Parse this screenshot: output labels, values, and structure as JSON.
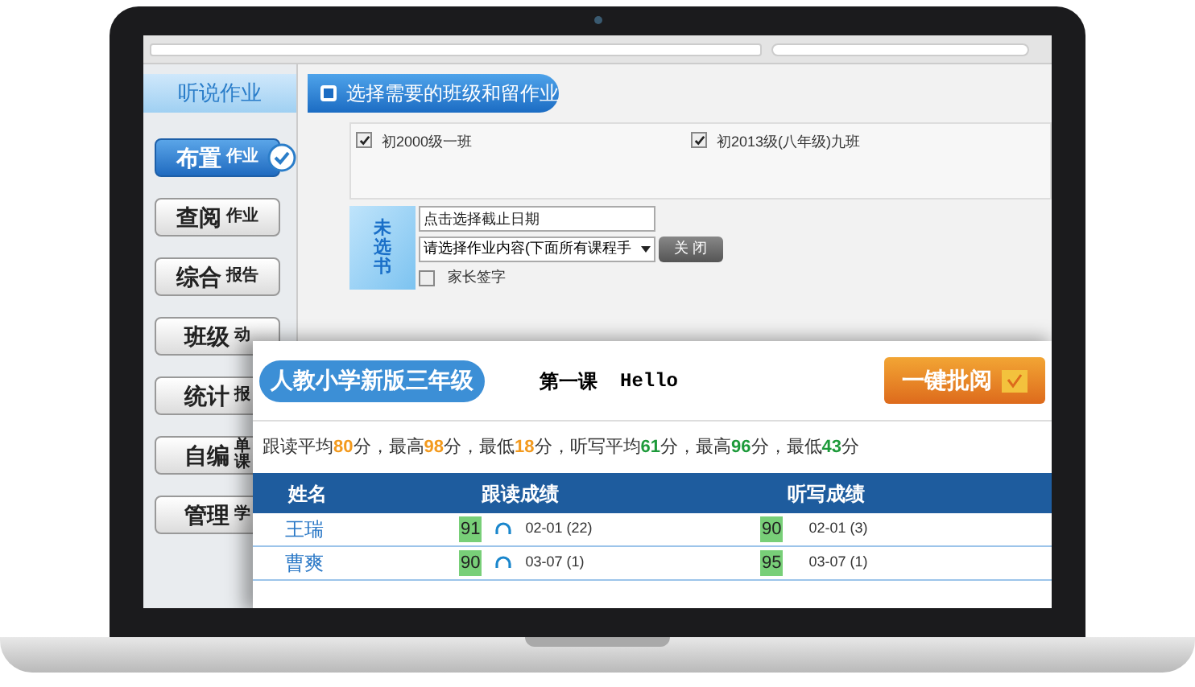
{
  "sidebar": {
    "title": "听说作业",
    "items": [
      {
        "main": "布置",
        "sub": [
          "作业"
        ],
        "selected": true
      },
      {
        "main": "查阅",
        "sub": [
          "作业"
        ],
        "selected": false
      },
      {
        "main": "综合",
        "sub": [
          "报告"
        ],
        "selected": false
      },
      {
        "main": "班级",
        "sub": [
          "动"
        ],
        "selected": false
      },
      {
        "main": "统计",
        "sub": [
          "报"
        ],
        "selected": false
      },
      {
        "main": "自编",
        "sub": [
          "单",
          "课"
        ],
        "selected": false
      },
      {
        "main": "管理",
        "sub": [
          "学"
        ],
        "selected": false
      }
    ]
  },
  "assign_panel": {
    "title": "选择需要的班级和留作业",
    "classes": [
      {
        "label": "初2000级一班",
        "checked": true
      },
      {
        "label": "初2013级(八年级)九班",
        "checked": true
      }
    ],
    "book": "未选书",
    "date_field": {
      "placeholder": "点击选择截止日期"
    },
    "content_select": {
      "value": "请选择作业内容(下面所有课程手"
    },
    "close_button": "关 闭",
    "parent_sign": {
      "label": "家长签字",
      "checked": false
    }
  },
  "grading_panel": {
    "grade_badge": "人教小学新版三年级",
    "lesson": "第一课",
    "lesson_title": "Hello",
    "batch_button": "一键批阅",
    "summary": [
      {
        "text": "跟读平均"
      },
      {
        "text": "80",
        "color": "#f39a1e"
      },
      {
        "text": "分，最高"
      },
      {
        "text": "98",
        "color": "#f39a1e"
      },
      {
        "text": "分，最低"
      },
      {
        "text": "18",
        "color": "#f39a1e"
      },
      {
        "text": "分，听写平均"
      },
      {
        "text": "61",
        "color": "#1d9a3a"
      },
      {
        "text": "分，最高"
      },
      {
        "text": "96",
        "color": "#1d9a3a"
      },
      {
        "text": "分，最低"
      },
      {
        "text": "43",
        "color": "#1d9a3a"
      },
      {
        "text": "分"
      }
    ],
    "table": {
      "columns": [
        "姓名",
        "跟读成绩",
        "听写成绩"
      ],
      "rows": [
        {
          "name": "王瑞",
          "read_score": "91",
          "read_detail": "02-01 (22)",
          "dict_score": "90",
          "dict_detail": "02-01 (3)"
        },
        {
          "name": "曹爽",
          "read_score": "90",
          "read_detail": "03-07 (1)",
          "dict_score": "95",
          "dict_detail": "03-07 (1)"
        }
      ]
    }
  }
}
